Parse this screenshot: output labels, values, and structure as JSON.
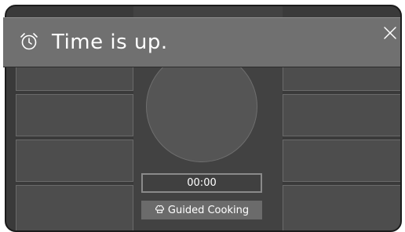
{
  "notification": {
    "message": "Time is up.",
    "alarm_icon": "alarm-clock-icon",
    "close_icon": "close-icon"
  },
  "timer": {
    "value": "00:00"
  },
  "guided_cooking": {
    "label": "Guided Cooking",
    "icon": "chef-hat-icon"
  },
  "colors": {
    "banner_bg": "#707070",
    "device_bg": "#3a3a3a",
    "tile_bg": "#4d4d4d",
    "text": "#ffffff"
  }
}
